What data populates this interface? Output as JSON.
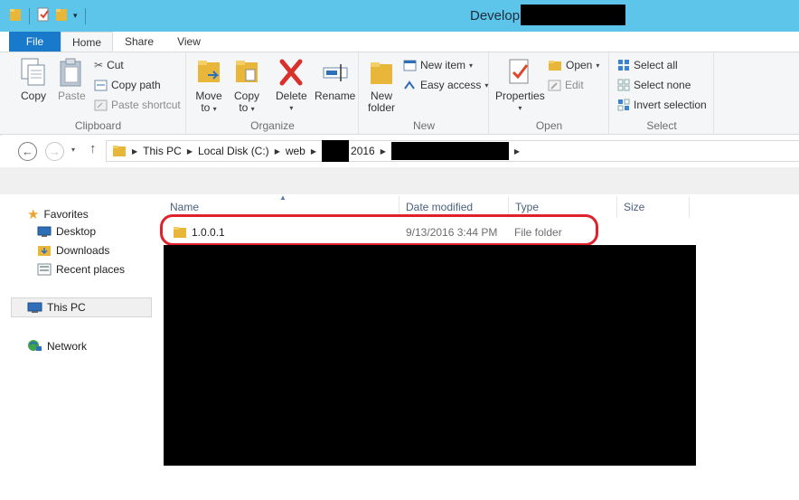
{
  "titlebar": {
    "title": "Develop"
  },
  "tabs": {
    "file": "File",
    "home": "Home",
    "share": "Share",
    "view": "View"
  },
  "ribbon": {
    "clipboard": {
      "label": "Clipboard",
      "copy": "Copy",
      "paste": "Paste",
      "cut": "Cut",
      "copy_path": "Copy path",
      "paste_shortcut": "Paste shortcut"
    },
    "organize": {
      "label": "Organize",
      "move_to_1": "Move",
      "move_to_2": "to",
      "copy_to_1": "Copy",
      "copy_to_2": "to",
      "delete": "Delete",
      "rename": "Rename"
    },
    "new": {
      "label": "New",
      "new_folder_1": "New",
      "new_folder_2": "folder",
      "new_item": "New item",
      "easy_access": "Easy access"
    },
    "open": {
      "label": "Open",
      "properties": "Properties",
      "open": "Open",
      "edit": "Edit"
    },
    "select": {
      "label": "Select",
      "select_all": "Select all",
      "select_none": "Select none",
      "invert_selection": "Invert selection"
    }
  },
  "address": {
    "crumbs": [
      "This PC",
      "Local Disk (C:)",
      "web",
      "2016"
    ]
  },
  "navpane": {
    "favorites": "Favorites",
    "desktop": "Desktop",
    "downloads": "Downloads",
    "recent": "Recent places",
    "thispc": "This PC",
    "network": "Network"
  },
  "filelist": {
    "columns": {
      "name": "Name",
      "date": "Date modified",
      "type": "Type",
      "size": "Size"
    },
    "rows": [
      {
        "name": "1.0.0.1",
        "date": "9/13/2016 3:44 PM",
        "type": "File folder",
        "size": ""
      }
    ]
  },
  "colors": {
    "titlebar": "#5ec5ea",
    "file_tab": "#1979ca",
    "highlight": "#e0202a"
  }
}
